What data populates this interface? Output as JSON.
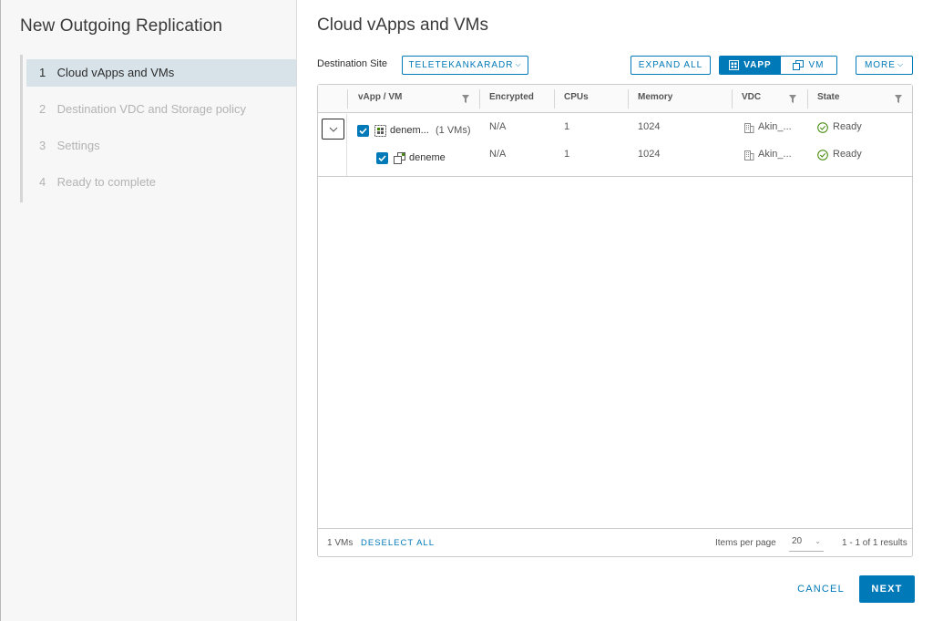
{
  "wizard": {
    "title": "New Outgoing Replication",
    "steps": [
      {
        "num": "1",
        "label": "Cloud vApps and VMs"
      },
      {
        "num": "2",
        "label": "Destination VDC and Storage policy"
      },
      {
        "num": "3",
        "label": "Settings"
      },
      {
        "num": "4",
        "label": "Ready to complete"
      }
    ]
  },
  "main": {
    "title": "Cloud vApps and VMs",
    "destination_label": "Destination Site",
    "destination_value": "TELETEKANKARADR",
    "expand_all_label": "EXPAND ALL",
    "view_toggle": {
      "vapp": "VAPP",
      "vm": "VM",
      "selected": "VAPP"
    },
    "more_label": "MORE"
  },
  "grid": {
    "columns": [
      "vApp / VM",
      "Encrypted",
      "CPUs",
      "Memory",
      "VDC",
      "State"
    ],
    "rows": [
      {
        "name": "denem...",
        "vm_count": "(1 VMs)",
        "encrypted": "N/A",
        "cpus": "1",
        "memory": "1024",
        "vdc": "Akin_...",
        "state": "Ready"
      },
      {
        "name": "deneme",
        "encrypted": "N/A",
        "cpus": "1",
        "memory": "1024",
        "vdc": "Akin_...",
        "state": "Ready"
      }
    ],
    "footer": {
      "selected_count": "1 VMs",
      "deselect_label": "DESELECT ALL",
      "items_per_page_label": "Items per page",
      "items_per_page_value": "20",
      "results_text": "1 - 1 of 1 results"
    }
  },
  "actions": {
    "cancel": "CANCEL",
    "next": "NEXT"
  },
  "colors": {
    "accent": "#0079b8",
    "success": "#3c8500",
    "nav_active": "#d8e3e9"
  }
}
